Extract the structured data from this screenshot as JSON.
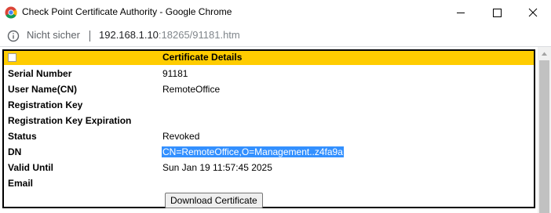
{
  "window": {
    "title": "Check Point Certificate Authority - Google Chrome",
    "icon": "chrome-icon",
    "controls": [
      "minimize-icon",
      "maximize-icon",
      "close-icon"
    ]
  },
  "address_bar": {
    "security_label": "Nicht sicher",
    "url_host": "192.168.1.10",
    "url_rest": ":18265/91181.htm"
  },
  "certificate": {
    "header": "Certificate Details",
    "header_color": "#ffcc00",
    "fields": [
      {
        "label": "Serial Number",
        "value": "91181"
      },
      {
        "label": "User Name(CN)",
        "value": "RemoteOffice"
      },
      {
        "label": "Registration Key",
        "value": ""
      },
      {
        "label": "Registration Key Expiration",
        "value": ""
      },
      {
        "label": "Status",
        "value": "Revoked"
      },
      {
        "label": "DN",
        "value": "CN=RemoteOffice,O=Management..z4fa9a"
      },
      {
        "label": "Valid Until",
        "value": "Sun Jan 19 11:57:45 2025"
      },
      {
        "label": "Email",
        "value": ""
      }
    ],
    "download_label": "Download Certificate"
  },
  "selection_color": "#3390ff"
}
